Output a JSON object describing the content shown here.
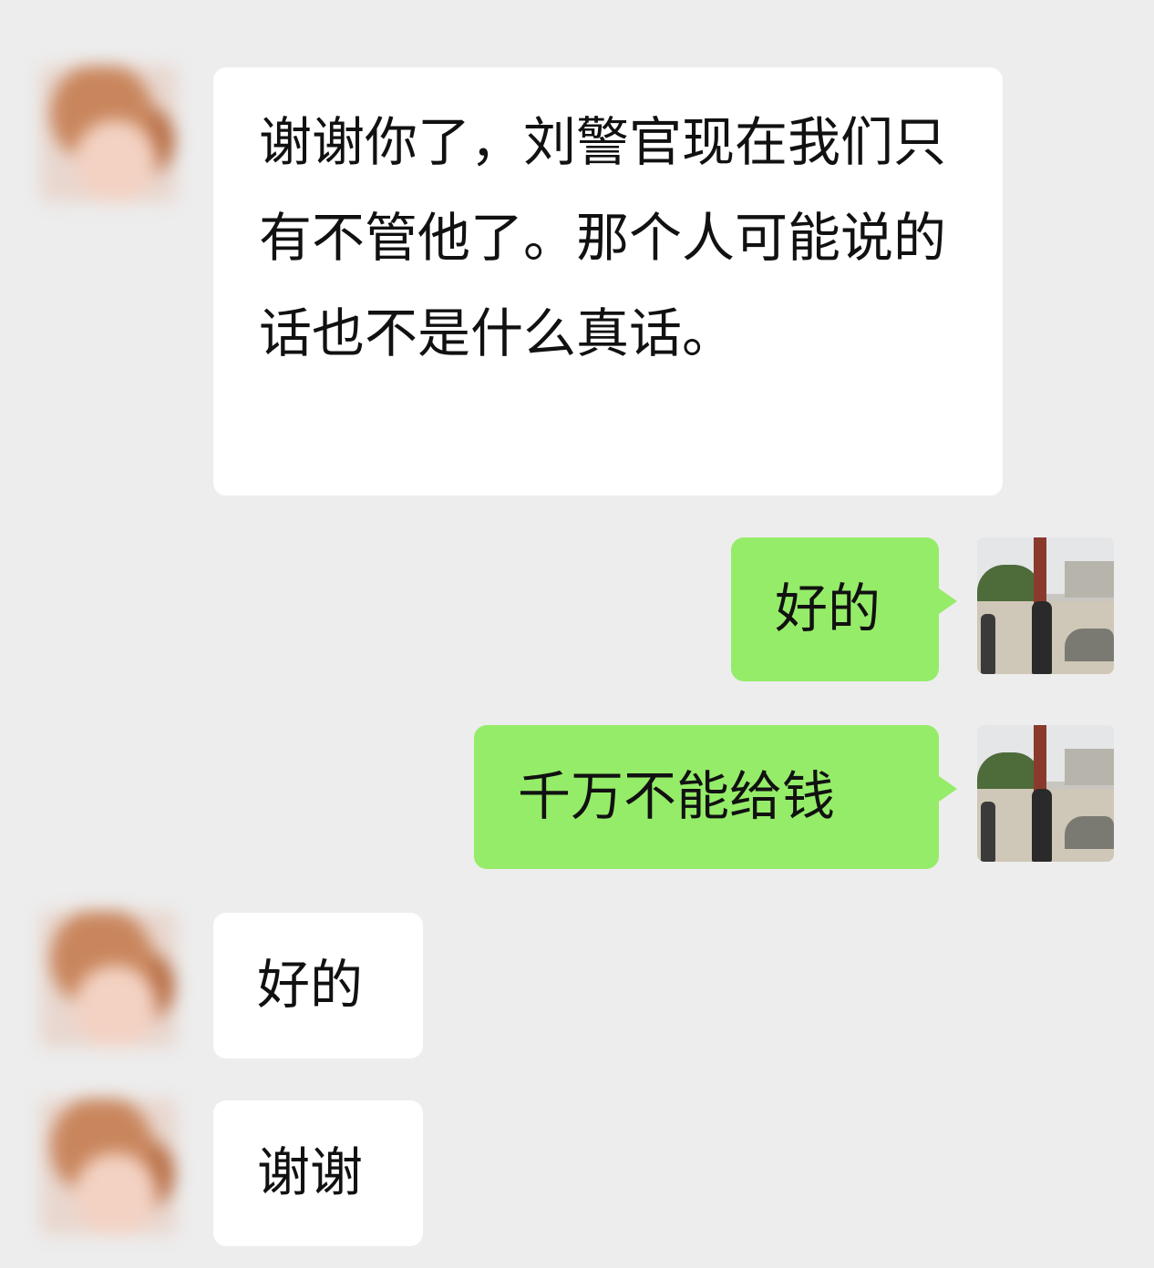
{
  "messages": [
    {
      "side": "in",
      "text": "谢谢你了，刘警官现在我们只有不管他了。那个人可能说的话也不是什么真话。"
    },
    {
      "side": "out",
      "text": "好的"
    },
    {
      "side": "out",
      "text": "千万不能给钱"
    },
    {
      "side": "in",
      "text": "好的"
    },
    {
      "side": "in",
      "text": "谢谢"
    }
  ],
  "colors": {
    "background": "#ededed",
    "incoming_bubble": "#ffffff",
    "outgoing_bubble": "#95ec69"
  }
}
